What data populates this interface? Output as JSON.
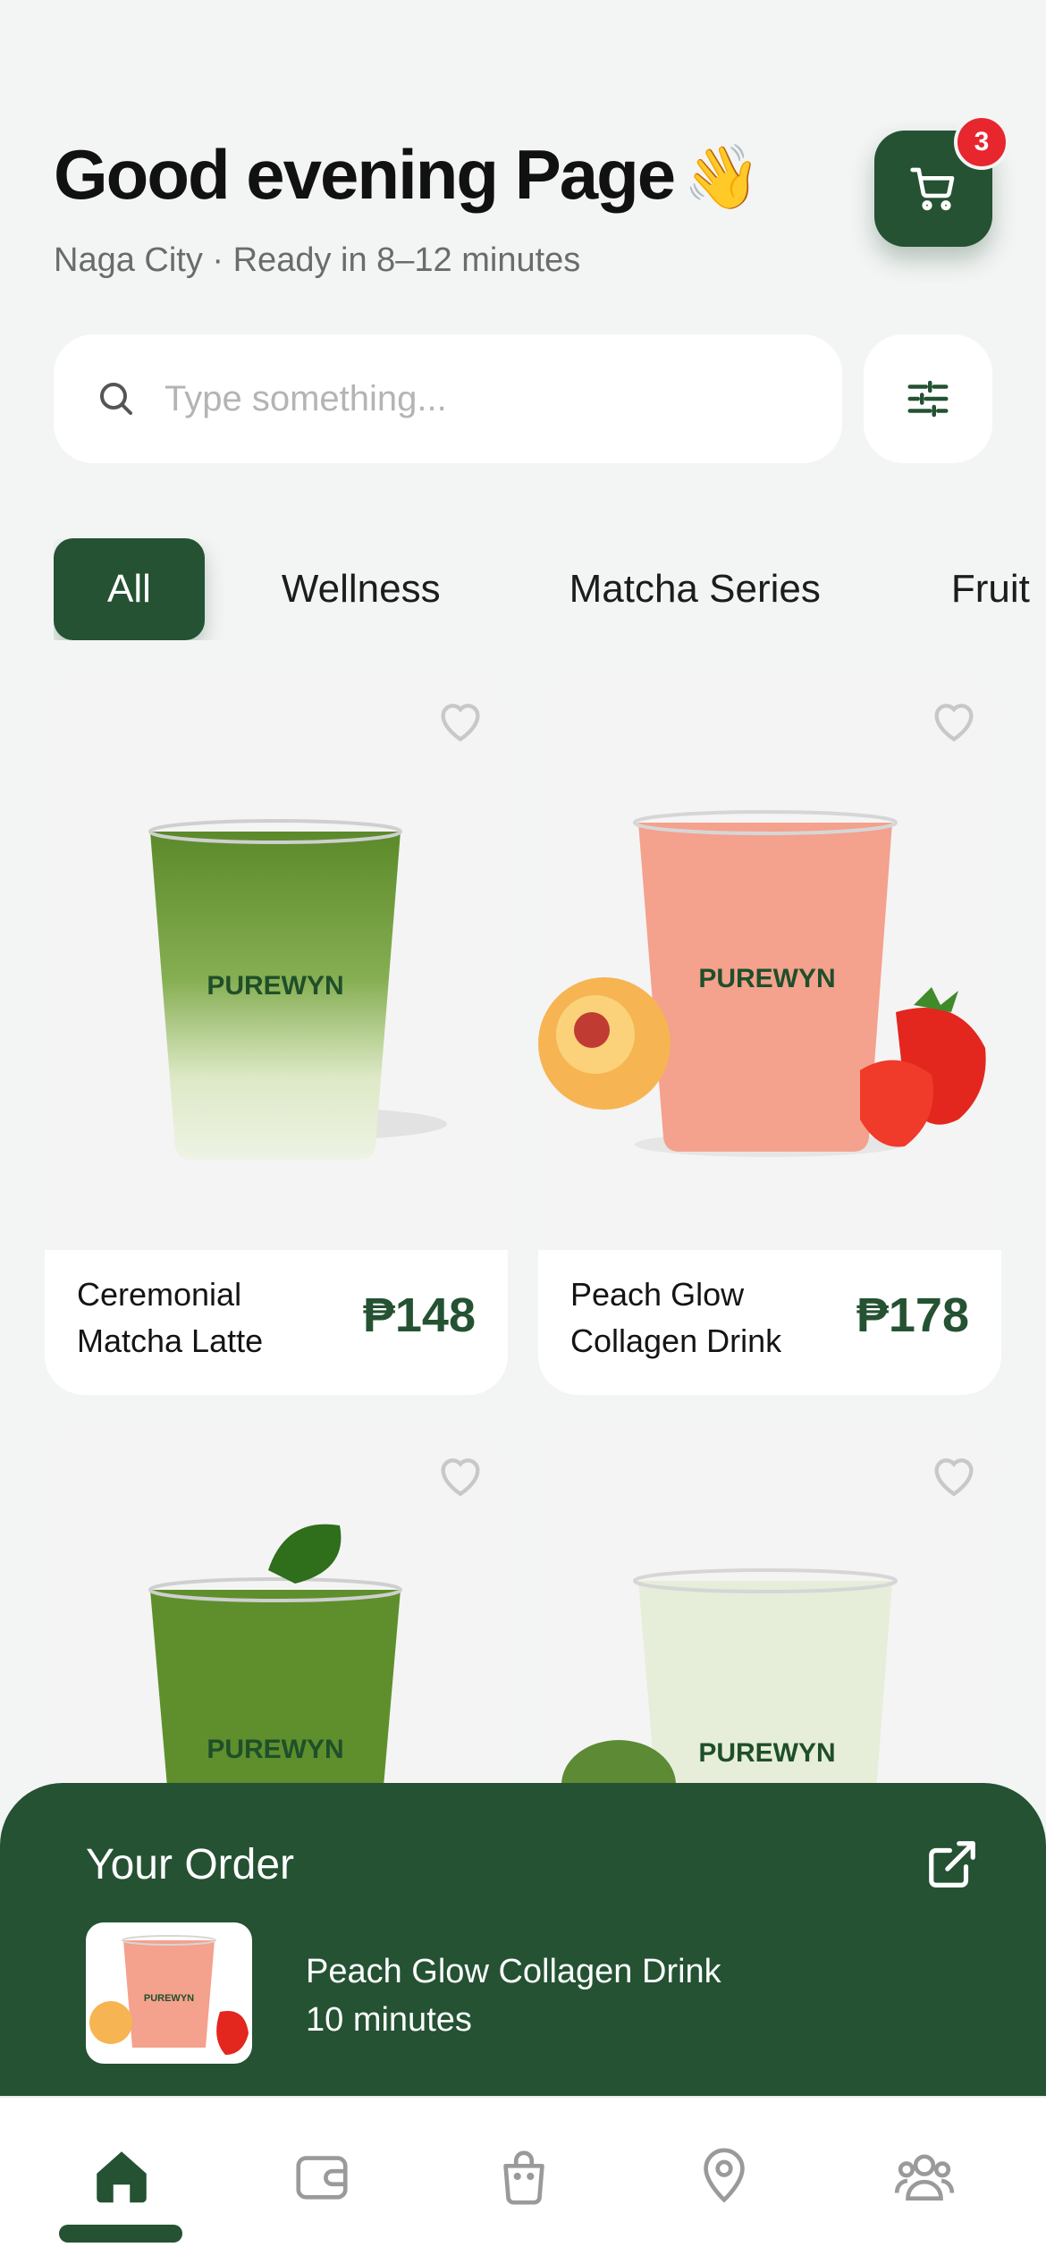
{
  "header": {
    "greeting": "Good evening Page",
    "wave": "👋",
    "subtitle": "Naga City · Ready in 8–12 minutes",
    "cart_count": "3"
  },
  "search": {
    "placeholder": "Type something..."
  },
  "categories": [
    "All",
    "Wellness",
    "Matcha Series",
    "Fruit"
  ],
  "products": [
    {
      "name": "Ceremonial Matcha Latte",
      "price": "₱148",
      "brand": "PUREWYN",
      "color": "#7fa84a"
    },
    {
      "name": "Peach Glow Collagen Drink",
      "price": "₱178",
      "brand": "PUREWYN",
      "color": "#f29a85"
    },
    {
      "name": "",
      "price": "",
      "brand": "PUREWYN",
      "color": "#5e8f2c"
    },
    {
      "name": "",
      "price": "",
      "brand": "PUREWYN",
      "color": "#e3ecd6"
    }
  ],
  "order": {
    "title": "Your Order",
    "item_name": "Peach Glow Collagen Drink",
    "eta": "10 minutes",
    "thumb_brand": "PUREWYN"
  },
  "tabs": [
    "home-icon",
    "wallet-icon",
    "shopping-bag-icon",
    "location-pin-icon",
    "users-icon"
  ],
  "colors": {
    "primary": "#245233",
    "badge": "#e8262e",
    "background": "#f3f4f4"
  }
}
